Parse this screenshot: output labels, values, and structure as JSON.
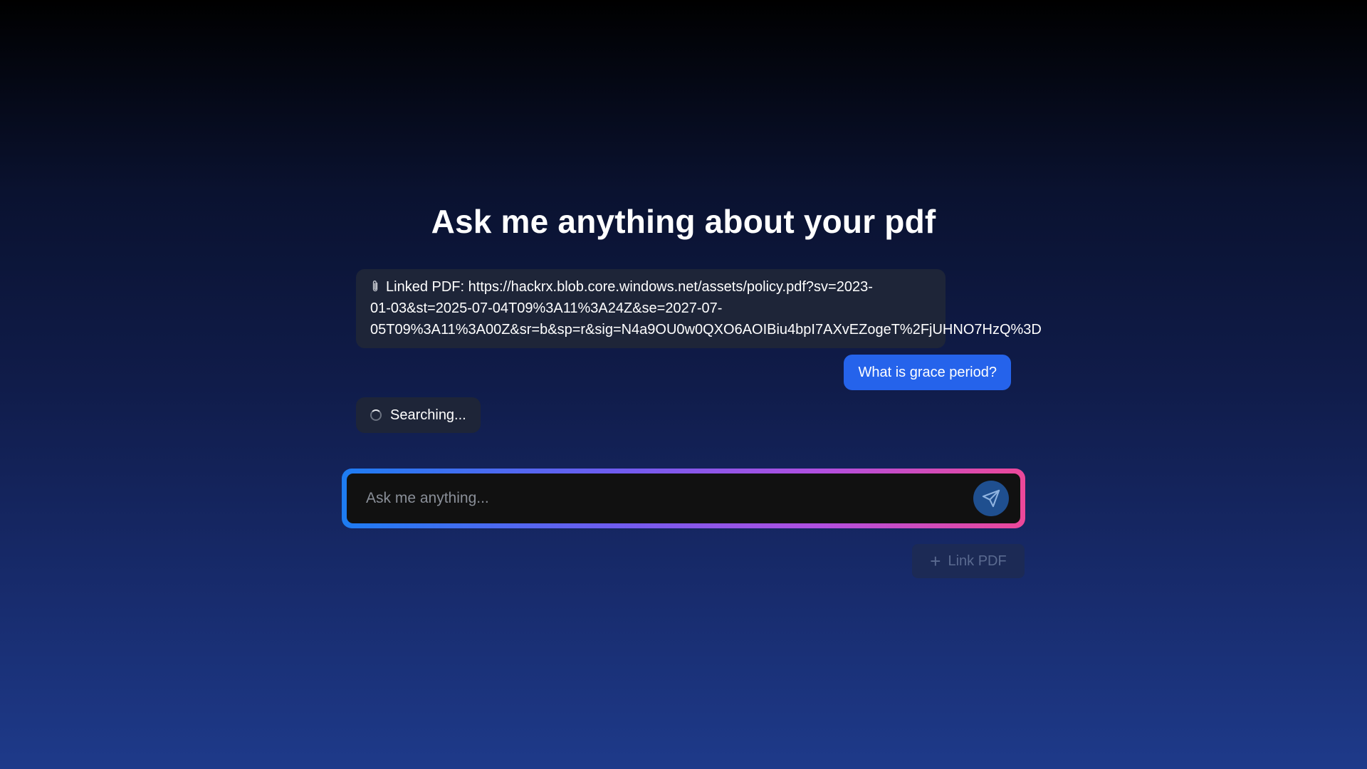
{
  "header": {
    "title": "Ask me anything about your pdf"
  },
  "messages": {
    "linked_pdf": {
      "icon": "paperclip-icon",
      "lines": [
        "Linked PDF: https://hackrx.blob.core.windows.net/assets/policy.pdf?sv=2023-",
        "01-03&st=2025-07-04T09%3A11%3A24Z&se=2027-07-",
        "05T09%3A11%3A00Z&sr=b&sp=r&sig=N4a9OU0w0QXO6AOIBiu4bpI7AXvEZogeT%2FjUHNO7HzQ%3D"
      ]
    },
    "user_question": "What is grace period?",
    "status": "Searching..."
  },
  "input": {
    "placeholder": "Ask me anything...",
    "value": "",
    "send_icon": "send-icon"
  },
  "actions": {
    "link_pdf_label": "Link PDF",
    "link_pdf_icon": "plus-icon"
  },
  "colors": {
    "user_bubble": "#2563eb",
    "assistant_bubble": "#1e2538",
    "input_border_start": "#1d7cf2",
    "input_border_end": "#ec4899",
    "send_button": "#1f4f8f"
  }
}
